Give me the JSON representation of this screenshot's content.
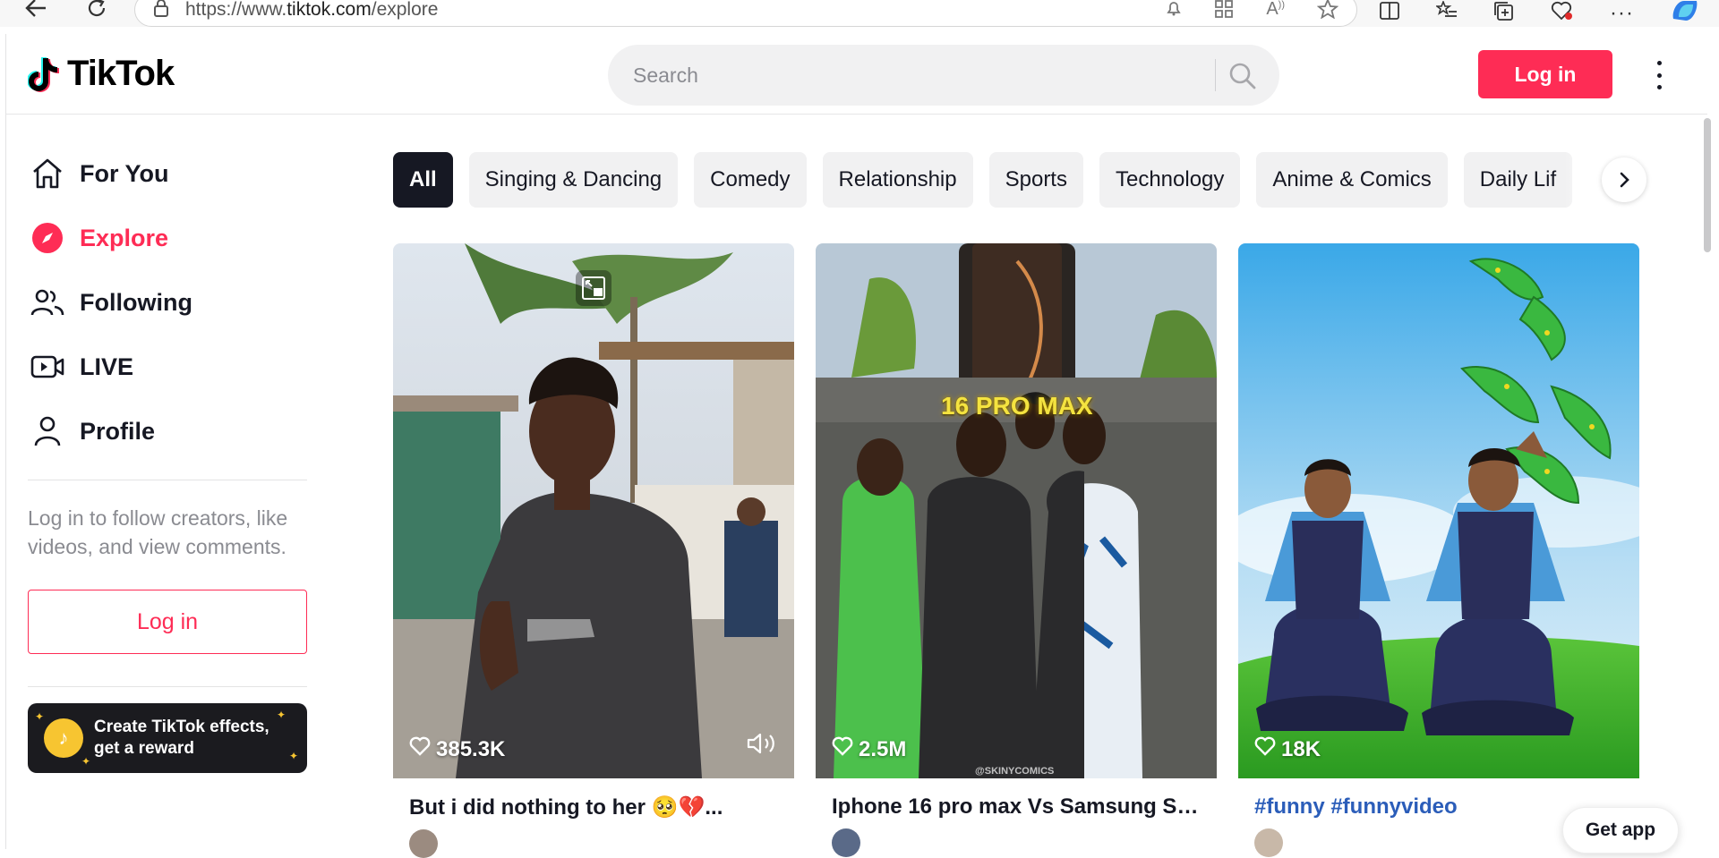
{
  "browser": {
    "url_prefix": "https://www.",
    "url_domain": "tiktok.com",
    "url_path": "/explore"
  },
  "header": {
    "logo_text": "TikTok",
    "search_placeholder": "Search",
    "login_label": "Log in"
  },
  "sidebar": {
    "items": [
      {
        "label": "For You",
        "icon": "home-icon"
      },
      {
        "label": "Explore",
        "icon": "compass-icon",
        "active": true
      },
      {
        "label": "Following",
        "icon": "people-icon"
      },
      {
        "label": "LIVE",
        "icon": "live-camera-icon"
      },
      {
        "label": "Profile",
        "icon": "person-icon"
      }
    ],
    "login_hint": "Log in to follow creators, like videos, and view comments.",
    "login_label": "Log in",
    "effects_text_line1": "Create TikTok effects,",
    "effects_text_line2": "get a reward"
  },
  "categories": [
    "All",
    "Singing & Dancing",
    "Comedy",
    "Relationship",
    "Sports",
    "Technology",
    "Anime & Comics",
    "Daily Lif"
  ],
  "videos": [
    {
      "likes": "385.3K",
      "caption": "But i did nothing to her 🥺💔..."
    },
    {
      "likes": "2.5M",
      "caption": "Iphone 16 pro max Vs Samsung S2...",
      "overlay_text": "16 PRO MAX",
      "watermark": "@SKINYCOMICS"
    },
    {
      "likes": "18K",
      "caption": "#funny #funnyvideo"
    }
  ],
  "get_app_label": "Get app",
  "colors": {
    "brand": "#fe2c55",
    "text": "#161823",
    "link": "#2b5db9"
  }
}
